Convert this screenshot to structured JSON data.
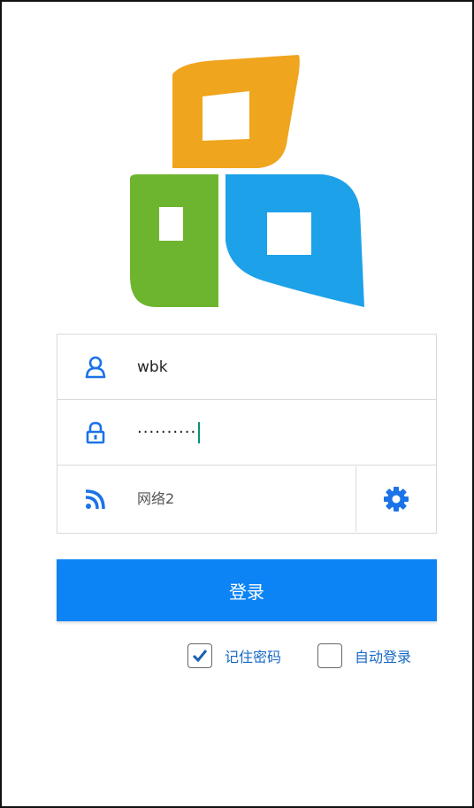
{
  "login": {
    "username": "wbk",
    "password_mask": "··········",
    "network": "网络2",
    "login_label": "登录",
    "remember_password": {
      "label": "记住密码",
      "checked": true
    },
    "auto_login": {
      "label": "自动登录",
      "checked": false
    }
  },
  "icons": {
    "username": "user-icon",
    "password": "lock-icon",
    "network": "wifi-icon",
    "settings": "gear-icon",
    "logo": "app-logo"
  },
  "colors": {
    "accent": "#0d84f5",
    "icon_blue": "#1a73e8",
    "logo_orange": "#f0a51e",
    "logo_green": "#6db52f",
    "logo_blue": "#1da1e8",
    "link_text": "#1769c4"
  }
}
